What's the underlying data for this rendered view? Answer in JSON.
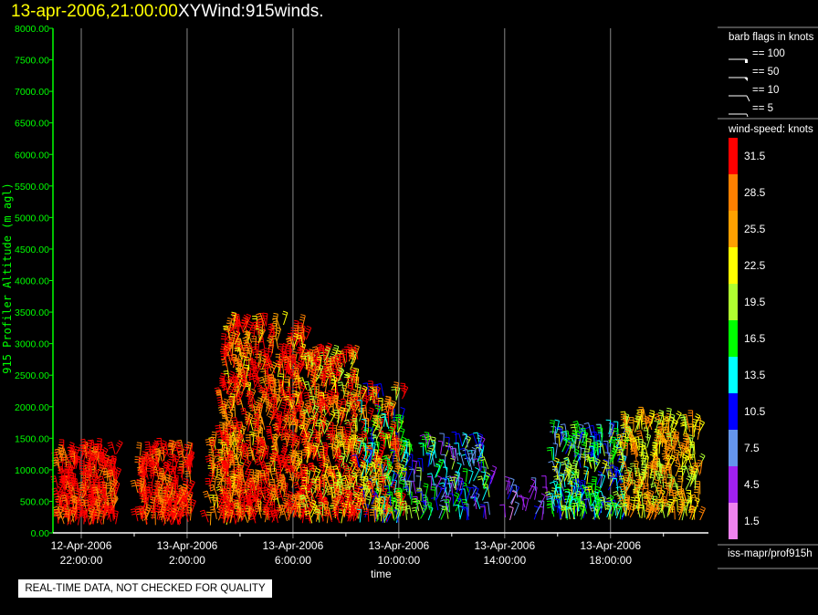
{
  "header": {
    "date": "13-apr-2006,21:00:00",
    "name": "XYWind:915winds."
  },
  "quality_notice": "REAL-TIME DATA, NOT CHECKED FOR QUALITY",
  "legend": {
    "barb_title": "barb flags in knots",
    "barb_samples": [
      "== 100",
      "== 50",
      "== 10",
      "== 5"
    ],
    "speed_title": "wind-speed: knots",
    "source": "iss-mapr/prof915h"
  },
  "chart_data": {
    "type": "scatter",
    "subtype": "wind-barb time-height",
    "xlabel": "time",
    "ylabel": "915 Profiler Altitude (m agl)",
    "ylim": [
      0,
      8000
    ],
    "yticks": [
      "0.00",
      "500.00",
      "1000.00",
      "1500.00",
      "2000.00",
      "2500.00",
      "3000.00",
      "3500.00",
      "4000.00",
      "4500.00",
      "5000.00",
      "5500.00",
      "6000.00",
      "6500.00",
      "7000.00",
      "7500.00",
      "8000.00"
    ],
    "x_unit": "hours after 12-Apr-2006 22:00:00",
    "xlim": [
      -1.07,
      23.7
    ],
    "xticks": [
      {
        "hour": 0,
        "date": "12-Apr-2006",
        "time": "22:00:00"
      },
      {
        "hour": 4,
        "date": "13-Apr-2006",
        "time": "2:00:00"
      },
      {
        "hour": 8,
        "date": "13-Apr-2006",
        "time": "6:00:00"
      },
      {
        "hour": 12,
        "date": "13-Apr-2006",
        "time": "10:00:00"
      },
      {
        "hour": 16,
        "date": "13-Apr-2006",
        "time": "14:00:00"
      },
      {
        "hour": 20,
        "date": "13-Apr-2006",
        "time": "18:00:00"
      }
    ],
    "minor_ticks_hours": [
      2,
      6,
      10,
      14,
      18,
      22
    ],
    "colorbar": [
      {
        "label": "31.5",
        "color": "#ff0000"
      },
      {
        "label": "28.5",
        "color": "#ff8000"
      },
      {
        "label": "25.5",
        "color": "#ffa000"
      },
      {
        "label": "22.5",
        "color": "#ffff00"
      },
      {
        "label": "19.5",
        "color": "#b0ff30"
      },
      {
        "label": "16.5",
        "color": "#00ff00"
      },
      {
        "label": "13.5",
        "color": "#00ffff"
      },
      {
        "label": "10.5",
        "color": "#0000ff"
      },
      {
        "label": "7.5",
        "color": "#6495ed"
      },
      {
        "label": "4.5",
        "color": "#a020f0"
      },
      {
        "label": "1.5",
        "color": "#ee82ee"
      }
    ],
    "clusters": [
      {
        "t": [
          -0.9,
          1.35
        ],
        "alt": [
          120,
          1300
        ],
        "speed": 31,
        "spread": 3,
        "count": 260
      },
      {
        "t": [
          2.1,
          4.2
        ],
        "alt": [
          120,
          1300
        ],
        "speed": 31,
        "spread": 3,
        "count": 220
      },
      {
        "t": [
          4.8,
          6.1
        ],
        "alt": [
          120,
          1500
        ],
        "speed": 28,
        "spread": 6,
        "count": 80
      },
      {
        "t": [
          5.3,
          8.5
        ],
        "alt": [
          150,
          3300
        ],
        "speed": 30,
        "spread": 7,
        "count": 650
      },
      {
        "t": [
          8.5,
          10.5
        ],
        "alt": [
          150,
          2800
        ],
        "speed": 28,
        "spread": 10,
        "count": 420
      },
      {
        "t": [
          10.5,
          12.2
        ],
        "alt": [
          150,
          2200
        ],
        "speed": 22,
        "spread": 12,
        "count": 260
      },
      {
        "t": [
          12.2,
          15.5
        ],
        "alt": [
          200,
          1400
        ],
        "speed": 12,
        "spread": 8,
        "count": 170
      },
      {
        "t": [
          16.0,
          17.6
        ],
        "alt": [
          200,
          700
        ],
        "speed": 6,
        "spread": 4,
        "count": 25
      },
      {
        "t": [
          17.8,
          20.5
        ],
        "alt": [
          200,
          1600
        ],
        "speed": 15,
        "spread": 7,
        "count": 260
      },
      {
        "t": [
          20.5,
          23.4
        ],
        "alt": [
          200,
          1800
        ],
        "speed": 24,
        "spread": 6,
        "count": 300
      }
    ]
  }
}
